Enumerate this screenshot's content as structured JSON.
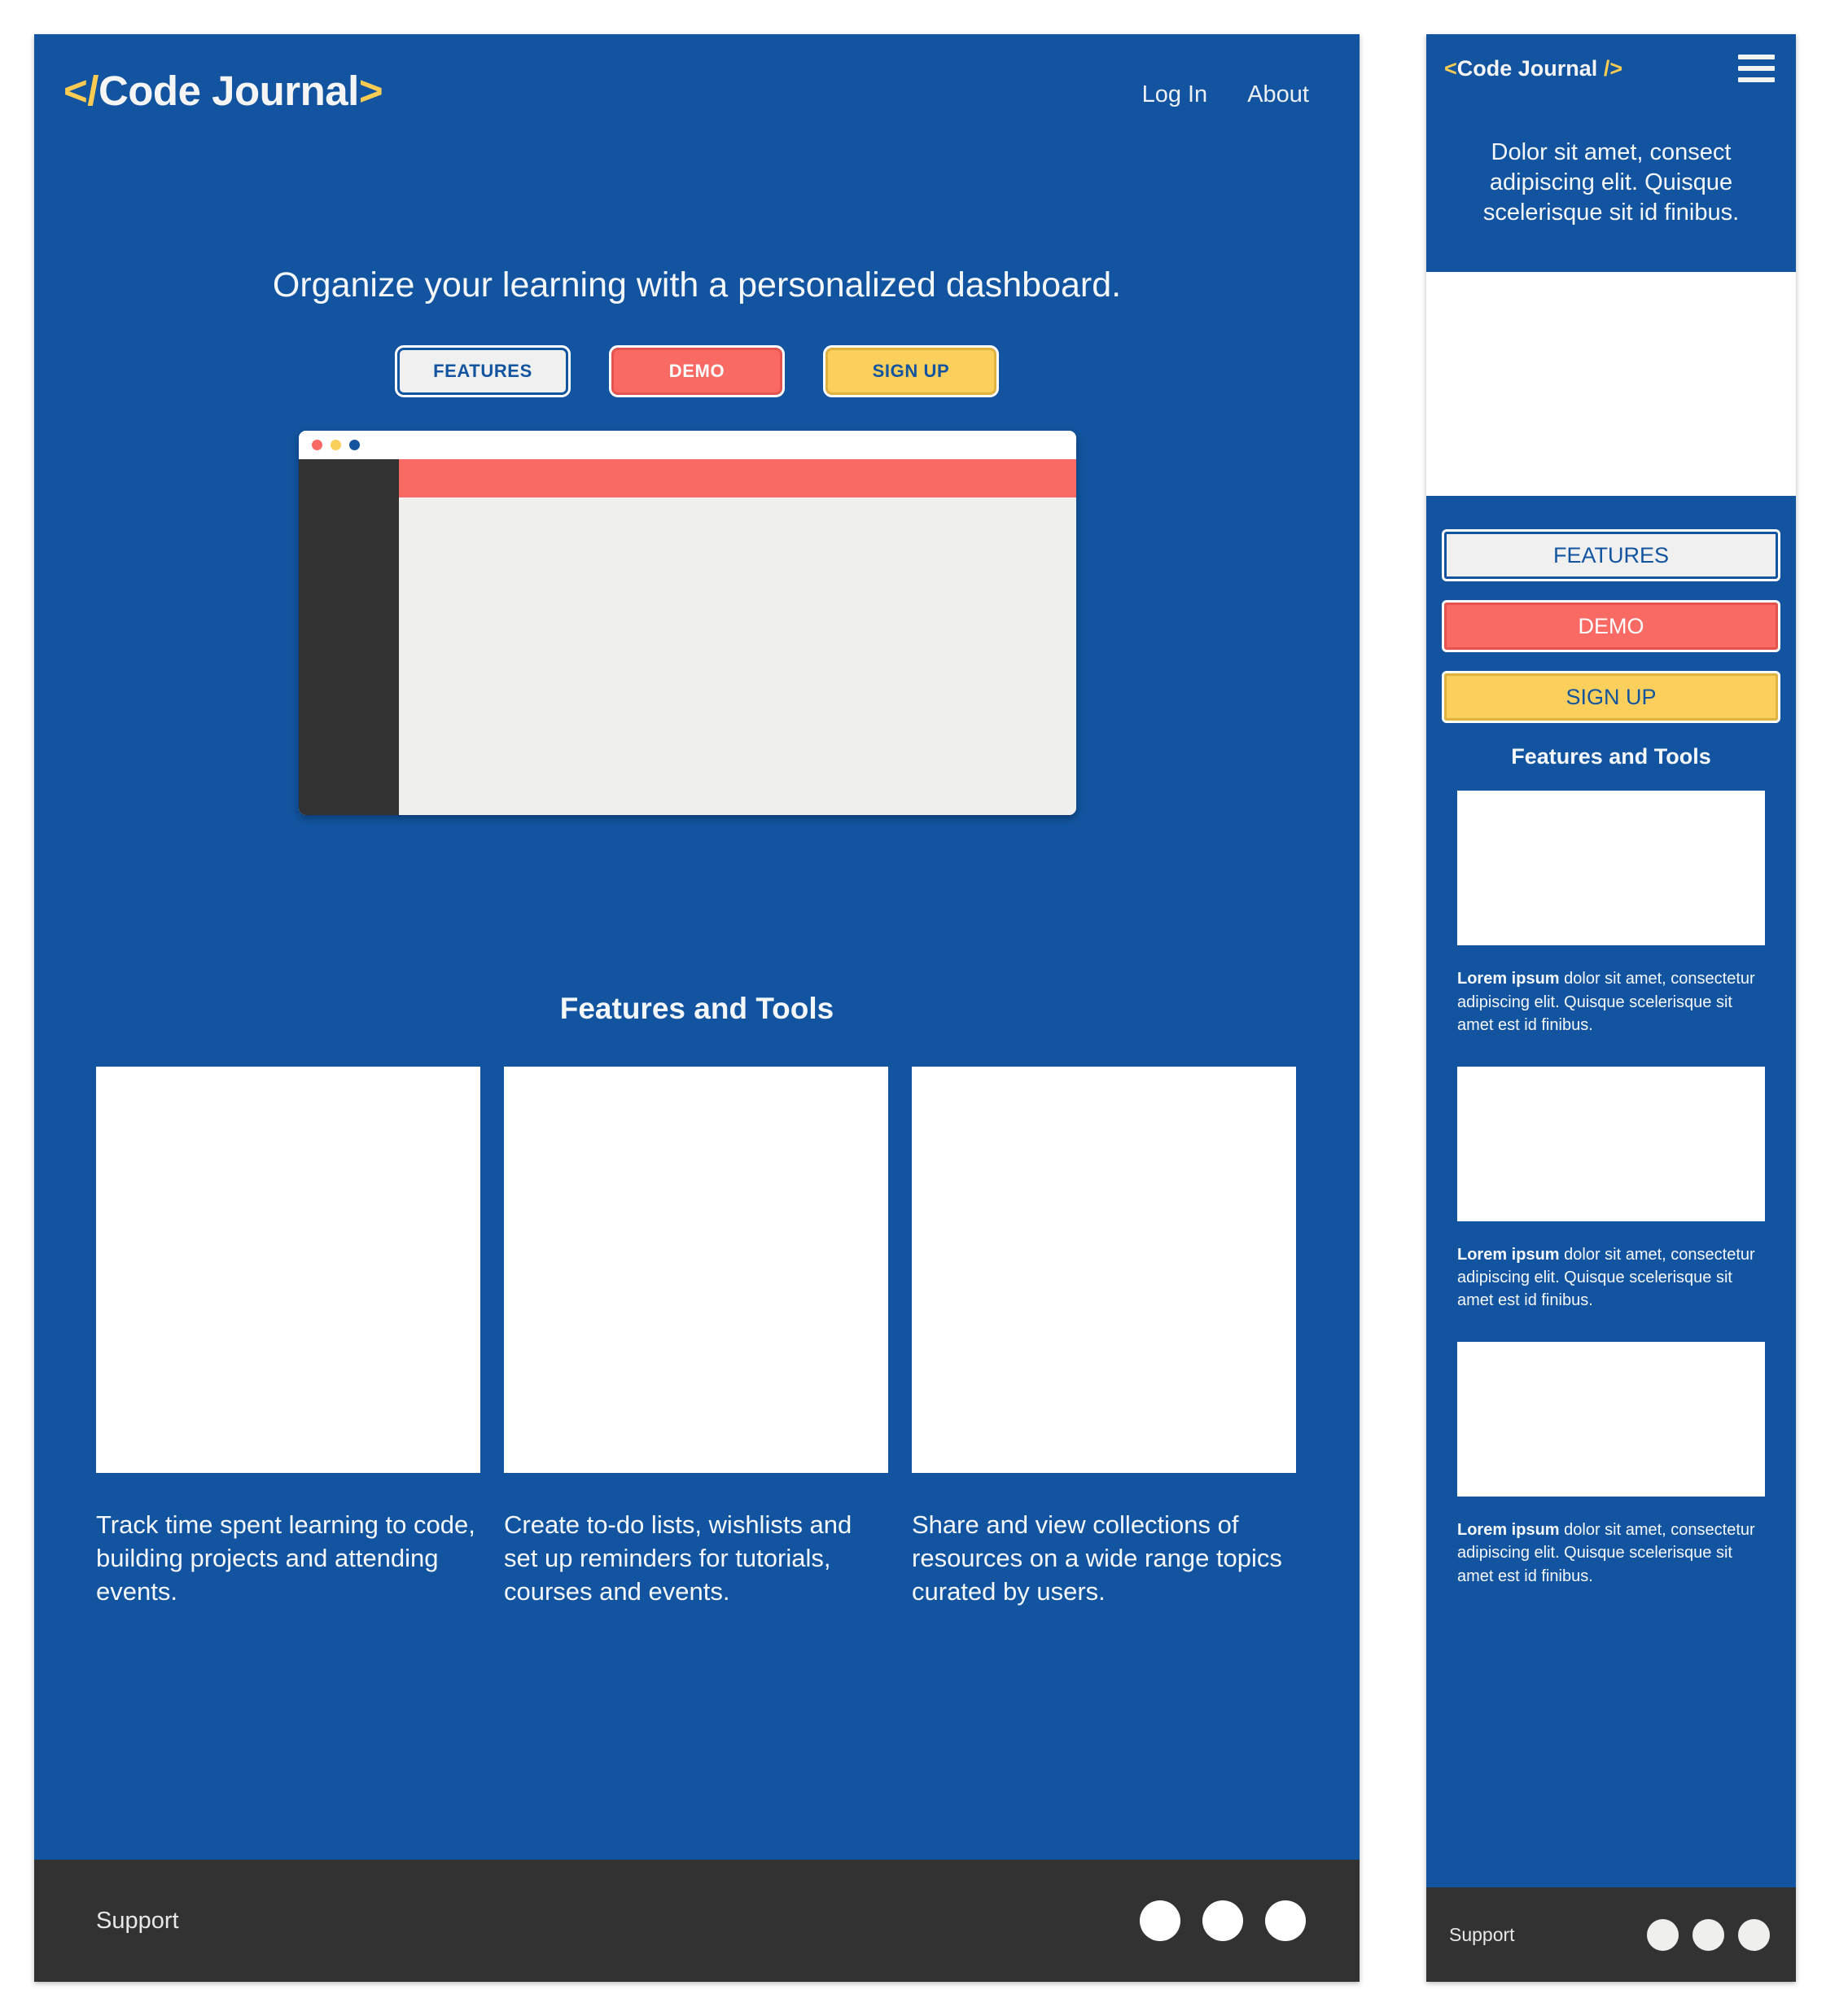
{
  "colors": {
    "brand_blue": "#12549F",
    "accent_yellow": "#FBCF5C",
    "accent_red": "#F96A64",
    "dark": "#323232",
    "light": "#EFEFED"
  },
  "desktop": {
    "logo": {
      "open": "</",
      "name": "Code Journal",
      "close": ">"
    },
    "nav": [
      {
        "label": "Log In"
      },
      {
        "label": "About"
      }
    ],
    "headline": "Organize your learning with a personalized dashboard.",
    "buttons": [
      {
        "label": "FEATURES"
      },
      {
        "label": "DEMO"
      },
      {
        "label": "SIGN UP"
      }
    ],
    "features_heading": "Features and Tools",
    "cards": [
      {
        "text": "Track time spent learning to code, building projects and attending events."
      },
      {
        "text": "Create to-do lists, wishlists and set up reminders for tutorials, courses and events."
      },
      {
        "text": "Share and view collections of resources on a wide range topics curated by users."
      }
    ],
    "footer": {
      "support_label": "Support",
      "social_count": 3
    }
  },
  "mobile": {
    "logo": {
      "open": "<",
      "name": "Code Journal ",
      "close": "/>"
    },
    "menu_icon": "hamburger-icon",
    "hero_text": "Dolor sit amet, consect adipiscing elit. Quisque scelerisque sit id finibus.",
    "buttons": [
      {
        "label": "FEATURES"
      },
      {
        "label": "DEMO"
      },
      {
        "label": "SIGN UP"
      }
    ],
    "features_heading": "Features and Tools",
    "items": [
      {
        "lead": "Lorem ipsum",
        "text": " dolor sit amet, consectetur adipiscing elit. Quisque scelerisque sit amet est id finibus."
      },
      {
        "lead": "Lorem ipsum",
        "text": " dolor sit amet, consectetur adipiscing elit. Quisque scelerisque sit amet est id finibus."
      },
      {
        "lead": "Lorem ipsum",
        "text": " dolor sit amet, consectetur adipiscing elit. Quisque scelerisque sit amet est id finibus."
      }
    ],
    "footer": {
      "support_label": "Support",
      "social_count": 3
    }
  }
}
